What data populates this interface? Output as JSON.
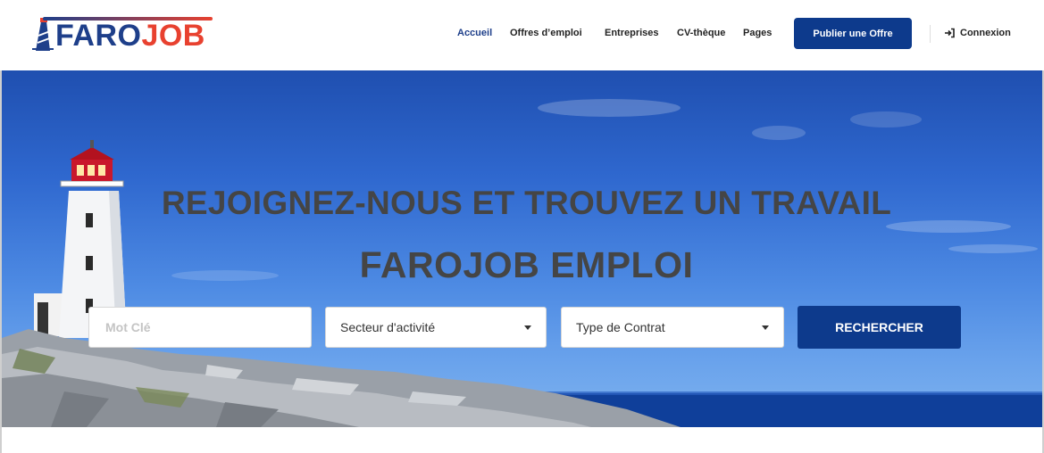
{
  "brand": {
    "logo_part1": "FARO",
    "logo_part2": "JOB"
  },
  "nav": {
    "items": [
      {
        "label": "Accueil",
        "active": true
      },
      {
        "label": "Offres d’emploi",
        "active": false
      },
      {
        "label": "Entreprises",
        "active": false
      },
      {
        "label": "CV-thèque",
        "active": false
      },
      {
        "label": "Pages",
        "active": false
      }
    ],
    "publish_label": "Publier une Offre",
    "login_label": "Connexion"
  },
  "hero": {
    "title": "REJOIGNEZ-NOUS ET TROUVEZ UN TRAVAIL",
    "subtitle": "FAROJOB EMPLOI"
  },
  "search": {
    "keyword_placeholder": "Mot Clé",
    "keyword_value": "",
    "sector_selected": "Secteur d'activité",
    "contract_selected": "Type de Contrat",
    "button_label": "RECHERCHER"
  },
  "colors": {
    "brand_blue": "#0d3a8c",
    "brand_red": "#e8412f",
    "heading_gray": "#454545"
  }
}
